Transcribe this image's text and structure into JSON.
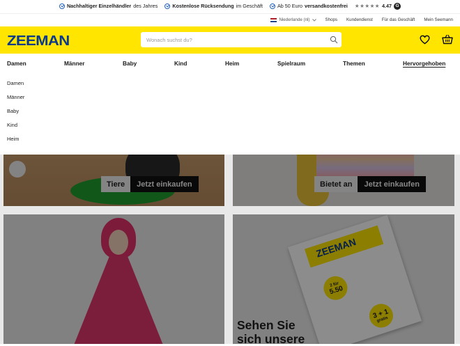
{
  "usp_bar": {
    "items": [
      {
        "bold": "Nachhaltiger Einzelhändler",
        "rest": " des Jahres"
      },
      {
        "bold": "Kostenlose Rücksendung",
        "rest": " im Geschäft"
      },
      {
        "pre": "Ab 50 Euro ",
        "bold": "versandkostenfrei"
      }
    ],
    "stars": "★★★★★",
    "rating": "4.47",
    "rating_badge": "G"
  },
  "service_bar": {
    "language": "Niederlande (nl)",
    "links": [
      "Shops",
      "Kundendienst",
      "Für das Geschäft",
      "Mein Seemann"
    ]
  },
  "header": {
    "logo": "ZEEMAN",
    "search_placeholder": "Wonach suchst du?",
    "brand_color": "#ffe500",
    "logo_color": "#0a3a8c"
  },
  "nav": {
    "items": [
      "Damen",
      "Männer",
      "Baby",
      "Kind",
      "Heim",
      "Spielraum",
      "Themen",
      "Hervorgehoben"
    ],
    "active": "Hervorgehoben"
  },
  "dropdown": {
    "items": [
      "Damen",
      "Männer",
      "Baby",
      "Kind",
      "Heim"
    ]
  },
  "cards": {
    "pets": {
      "label": "Tiere",
      "cta": "Jetzt einkaufen"
    },
    "textiles": {
      "label": "Bietet an",
      "cta": "Jetzt einkaufen"
    },
    "folder": {
      "title_line1": "Sehen Sie",
      "title_line2": "sich unsere",
      "badge_price_top": "2 für",
      "badge_price": "5.50",
      "badge_deal": "3 + 1",
      "badge_deal_sub": "gratis",
      "brochure_logo": "ZEEMAN"
    }
  },
  "icons": {
    "search": "search-icon",
    "wishlist": "heart-icon",
    "cart": "basket-icon"
  }
}
